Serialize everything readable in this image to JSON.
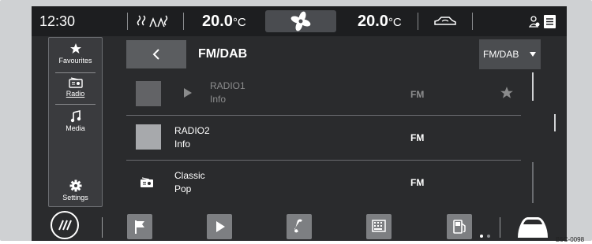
{
  "status_bar": {
    "time": "12:30",
    "left_temp": "20.0",
    "left_temp_unit": "°C",
    "right_temp": "20.0",
    "right_temp_unit": "°C"
  },
  "sidebar": {
    "items": [
      {
        "label": "Favourites",
        "icon": "star-icon"
      },
      {
        "label": "Radio",
        "icon": "radio-icon",
        "selected": true
      },
      {
        "label": "Media",
        "icon": "music-note-icon"
      },
      {
        "label": "Settings",
        "icon": "gear-icon"
      }
    ]
  },
  "header": {
    "title": "FM/DAB",
    "source_dropdown": "FM/DAB"
  },
  "stations": [
    {
      "name": "RADIO1",
      "info": "Info",
      "band": "FM",
      "playing": true,
      "favourite": true
    },
    {
      "name": "RADIO2",
      "info": "Info",
      "band": "FM"
    },
    {
      "name": "Classic",
      "info": "Pop",
      "band": "FM"
    }
  ],
  "figure_id": "B5C-0098",
  "colors": {
    "screen_bg": "#2a2b2d",
    "top_bar_bg": "#1d1e20",
    "highlight_button": "#5b5d60",
    "thumbnail": "#a7a9ac"
  }
}
